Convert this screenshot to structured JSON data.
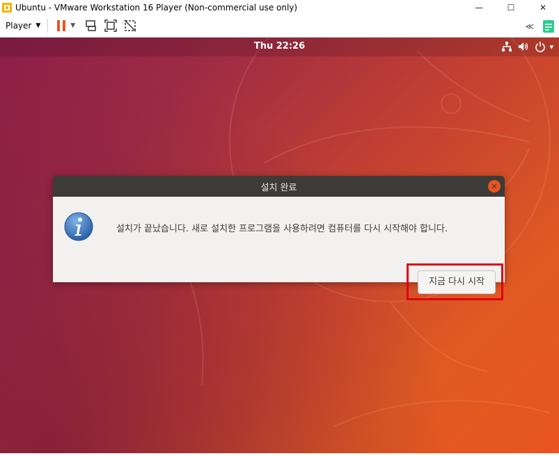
{
  "window": {
    "title": "Ubuntu - VMware Workstation 16 Player (Non-commercial use only)",
    "controls": {
      "minimize": "—",
      "maximize": "☐",
      "close": "✕"
    }
  },
  "toolbar": {
    "player_label": "Player",
    "player_caret": "▼",
    "pause_caret": "▼",
    "collapse_label": "≪",
    "icons": [
      "pause-icon",
      "send-ctrl-alt-del-icon",
      "fit-guest-icon",
      "unity-icon",
      "notes-icon"
    ]
  },
  "ubuntu_topbar": {
    "clock": "Thu 22:26",
    "tray_icons": [
      "network-icon",
      "volume-icon",
      "power-icon"
    ],
    "menu_caret": "▾"
  },
  "dialog": {
    "title": "설치 완료",
    "message": "설치가 끝났습니다. 새로 설치한 프로그램을 사용하려면 컴퓨터를 다시 시작해야 합니다.",
    "button_label": "지금 다시 시작",
    "close_glyph": "✕",
    "icon": "info-icon"
  },
  "colors": {
    "ubuntu_orange": "#e95420",
    "dialog_header": "#3c3b37",
    "dialog_body": "#f2f1f0",
    "highlight": "#e00010"
  }
}
